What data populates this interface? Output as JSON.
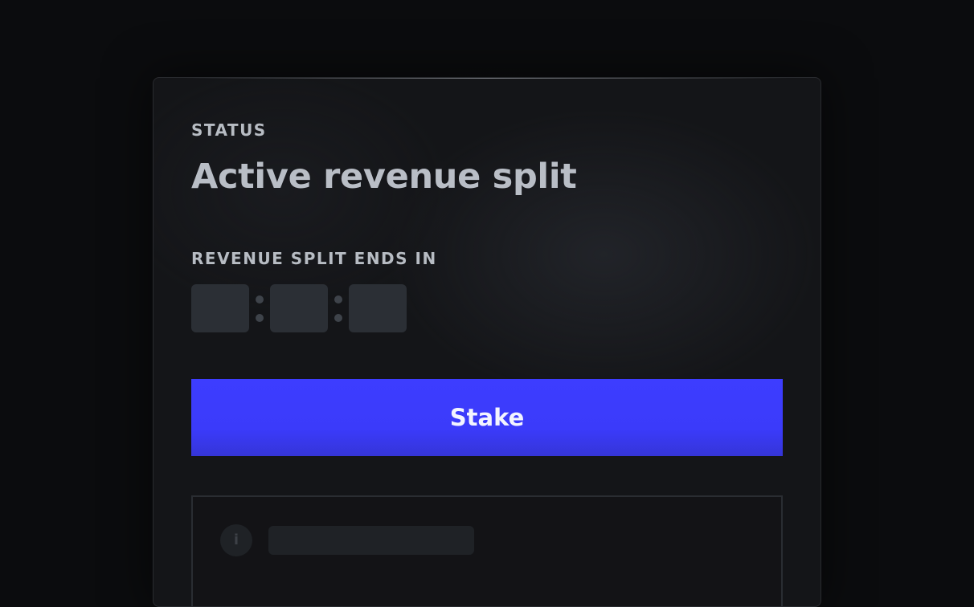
{
  "status": {
    "label": "STATUS",
    "value": "Active revenue split"
  },
  "countdown": {
    "label": "REVENUE SPLIT ENDS IN",
    "segments": [
      "",
      "",
      ""
    ],
    "loading": true
  },
  "actions": {
    "stake_label": "Stake"
  },
  "info": {
    "icon": "info-icon",
    "icon_glyph": "i",
    "text": "",
    "loading": true
  },
  "colors": {
    "accent": "#3d3dff",
    "background": "#0b0c0e",
    "card": "#141518",
    "text_muted": "#b7bcc3",
    "skeleton": "#2b2f35"
  }
}
